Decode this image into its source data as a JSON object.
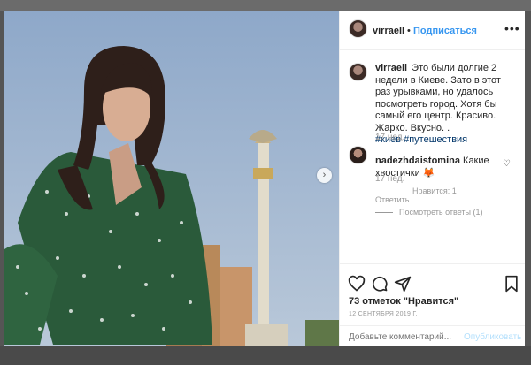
{
  "post": {
    "username": "virraell",
    "follow_label": "Подписаться",
    "dot": "•",
    "more_label": "•••",
    "caption_text": "Это были долгие 2 недели в Киеве. Зато в этот раз урывками, но удалось посмотреть город. Хотя бы самый его центр. Красиво. Жарко. Вкусно. .",
    "hashtags": [
      "#киев",
      "#путешествия"
    ],
    "caption_time": "17 нед."
  },
  "comment": {
    "username": "nadezhdaistomina",
    "text": "Какие хвостички",
    "emoji": "🦊",
    "time": "17 нед.",
    "likes": "Нравится: 1",
    "reply_label": "Ответить",
    "view_replies": "Посмотреть ответы (1)"
  },
  "footer": {
    "likes_count": "73 отметок \"Нравится\"",
    "date": "12 СЕНТЯБРЯ 2019 Г.",
    "add_comment_placeholder": "Добавьте комментарий...",
    "publish_label": "Опубликовать"
  },
  "icons": {
    "next": "chevron-right-icon",
    "like": "heart-icon",
    "comment": "comment-icon",
    "share": "paper-plane-icon",
    "save": "bookmark-icon"
  },
  "colors": {
    "accent": "#3897f0",
    "hashtag": "#003569",
    "muted": "#999999",
    "publish_disabled": "#b2dffc"
  }
}
